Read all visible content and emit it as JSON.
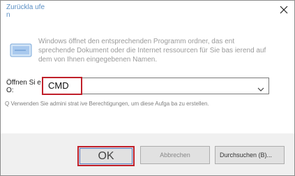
{
  "window": {
    "title": "Zurückla ufen"
  },
  "icons": {
    "close": "close-icon",
    "run": "run-icon",
    "dropdown": "chevron-down-icon"
  },
  "description": "Windows öffnet den entsprechenden Programm ordner, das ent sprechende Dokument oder die Internet ressourcen für Sie bas ierend auf dem von Ihnen eingegebenen Namen.",
  "open_field": {
    "label": "Öffnen Si e O:",
    "value": "CMD"
  },
  "hint": "Q Verwenden Sie admini strat ive Berechtigungen, um diese Aufga ba zu erstellen.",
  "buttons": {
    "ok": "OK",
    "cancel": "Abbrechen",
    "browse": "Durchsuchen (B)..."
  },
  "colors": {
    "highlight": "#c0202a",
    "title": "#5b8fc4",
    "footer_bg": "#f0f0f0"
  }
}
